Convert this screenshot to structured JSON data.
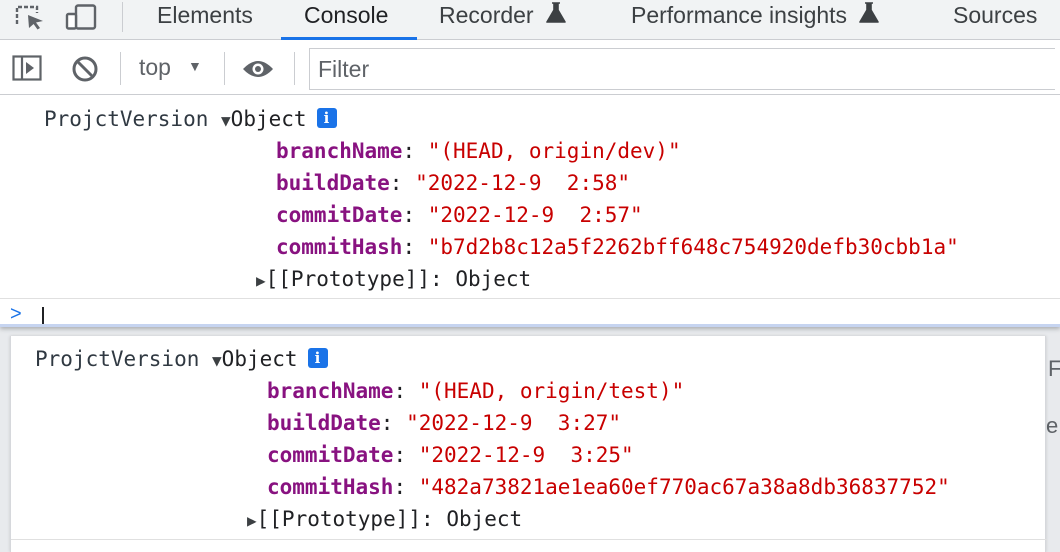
{
  "tabs": [
    {
      "label": "Elements"
    },
    {
      "label": "Console"
    },
    {
      "label": "Recorder",
      "icon": "flask-icon"
    },
    {
      "label": "Performance insights",
      "icon": "flask-icon"
    },
    {
      "label": "Sources"
    }
  ],
  "toolbar": {
    "context": "top",
    "filter_placeholder": "Filter",
    "icons": [
      "inspect-element-icon",
      "device-toolbar-icon",
      "sidebar-toggle-icon",
      "clear-console-icon",
      "live-expression-eye-icon"
    ]
  },
  "logs": [
    {
      "label": "ProjctVersion",
      "summary": "Object",
      "badge": "i",
      "props": [
        {
          "key": "branchName",
          "value": "\"(HEAD, origin/dev)\""
        },
        {
          "key": "buildDate",
          "value": "\"2022-12-9  2:58\""
        },
        {
          "key": "commitDate",
          "value": "\"2022-12-9  2:57\""
        },
        {
          "key": "commitHash",
          "value": "\"b7d2b8c12a5f2262bff648c754920defb30cbb1a\""
        }
      ],
      "prototype_key": "[[Prototype]]",
      "prototype_value": "Object"
    },
    {
      "label": "ProjctVersion",
      "summary": "Object",
      "badge": "i",
      "props": [
        {
          "key": "branchName",
          "value": "\"(HEAD, origin/test)\""
        },
        {
          "key": "buildDate",
          "value": "\"2022-12-9  3:27\""
        },
        {
          "key": "commitDate",
          "value": "\"2022-12-9  3:25\""
        },
        {
          "key": "commitHash",
          "value": "\"482a73821ae1ea60ef770ac67a38a8db36837752\""
        }
      ],
      "prototype_key": "[[Prototype]]",
      "prototype_value": "Object"
    }
  ],
  "prompt": {
    "chevron": ">"
  },
  "background_peek": [
    "F",
    "e"
  ],
  "colors": {
    "accent": "#1a73e8",
    "property_key": "#881280",
    "string_value": "#c80000"
  }
}
